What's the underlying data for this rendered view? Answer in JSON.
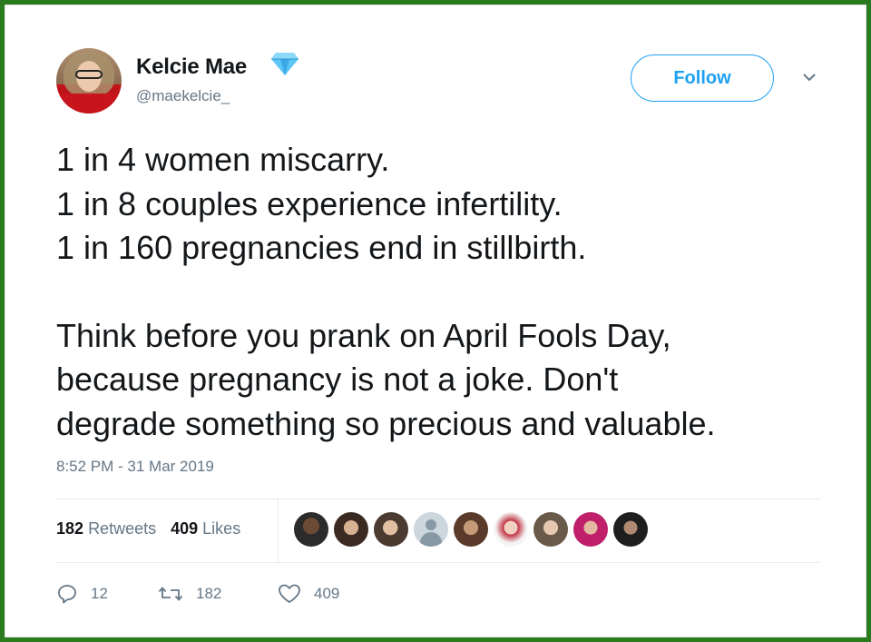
{
  "author": {
    "name": "Kelcie Mae",
    "handle": "@maekelcie_",
    "verified_icon": "diamond-icon"
  },
  "follow_label": "Follow",
  "tweet": {
    "lines_block1": [
      "1 in 4 women miscarry.",
      "1 in 8 couples experience infertility.",
      "1 in 160 pregnancies end in stillbirth."
    ],
    "lines_block2": [
      "Think before you prank on April Fools Day,",
      "because pregnancy is not a joke. Don't",
      "degrade something so precious and valuable."
    ],
    "timestamp": "8:52 PM - 31 Mar 2019"
  },
  "stats": {
    "retweets_count": "182",
    "retweets_label": "Retweets",
    "likes_count": "409",
    "likes_label": "Likes"
  },
  "actions": {
    "replies": "12",
    "retweets": "182",
    "likes": "409"
  },
  "colors": {
    "border": "#2a7a1e",
    "accent": "#1da1f2",
    "muted": "#657786",
    "text": "#14171a"
  }
}
